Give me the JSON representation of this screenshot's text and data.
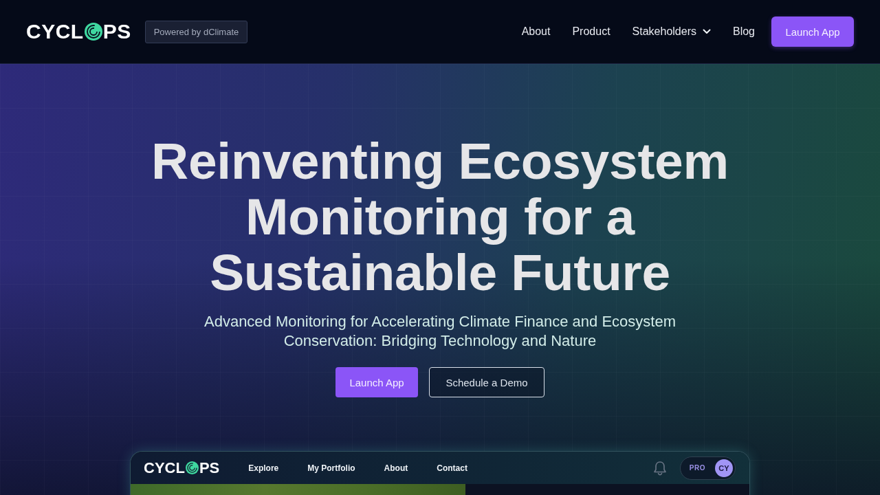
{
  "header": {
    "logo": {
      "start": "CYCL",
      "end": "PS"
    },
    "badge": "Powered by dClimate",
    "nav": [
      {
        "label": "About",
        "kind": "link"
      },
      {
        "label": "Product",
        "kind": "link"
      },
      {
        "label": "Stakeholders",
        "kind": "dropdown"
      },
      {
        "label": "Blog",
        "kind": "link"
      }
    ],
    "cta": "Launch App"
  },
  "hero": {
    "title": "Reinventing Ecosystem Monitoring for a Sustainable Future",
    "subtitle": "Advanced Monitoring for Accelerating Climate Finance and Ecosystem Conservation: Bridging Technology and Nature",
    "buttons": [
      {
        "label": "Launch App",
        "kind": "primary"
      },
      {
        "label": "Schedule a Demo",
        "kind": "outline"
      }
    ]
  },
  "app_preview": {
    "logo": {
      "start": "CYCL",
      "end": "PS"
    },
    "nav": [
      "Explore",
      "My Portfolio",
      "About",
      "Contact"
    ],
    "plan": "PRO",
    "avatar": "CY"
  }
}
